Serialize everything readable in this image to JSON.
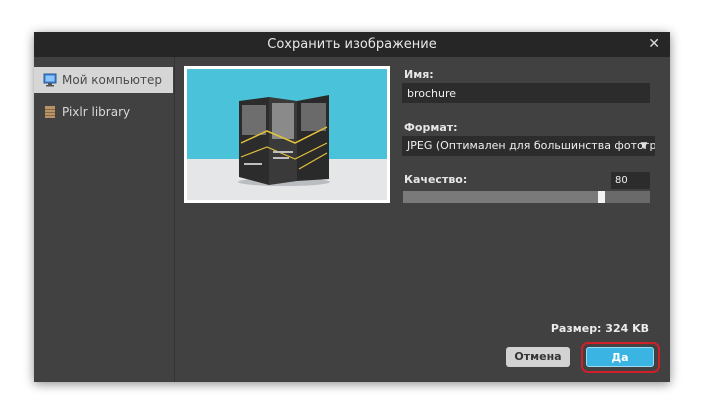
{
  "dialog": {
    "title": "Сохранить изображение",
    "close_symbol": "✕"
  },
  "sidebar": {
    "items": [
      {
        "label": "Мой компьютер",
        "icon": "monitor-icon",
        "active": true
      },
      {
        "label": "Pixlr library",
        "icon": "library-icon",
        "active": false
      }
    ]
  },
  "form": {
    "name_label": "Имя:",
    "name_value": "brochure",
    "format_label": "Формат:",
    "format_value": "JPEG (Оптимален для большинства фотографий)",
    "quality_label": "Качество:",
    "quality_value": "80",
    "quality_fraction": 0.8,
    "size_text": "Размер: 324 KB"
  },
  "buttons": {
    "cancel_label": "Отмена",
    "ok_label": "Да"
  },
  "colors": {
    "accent": "#3ab4e2",
    "highlight": "#cf1f2b",
    "dialog_bg": "#414141"
  }
}
